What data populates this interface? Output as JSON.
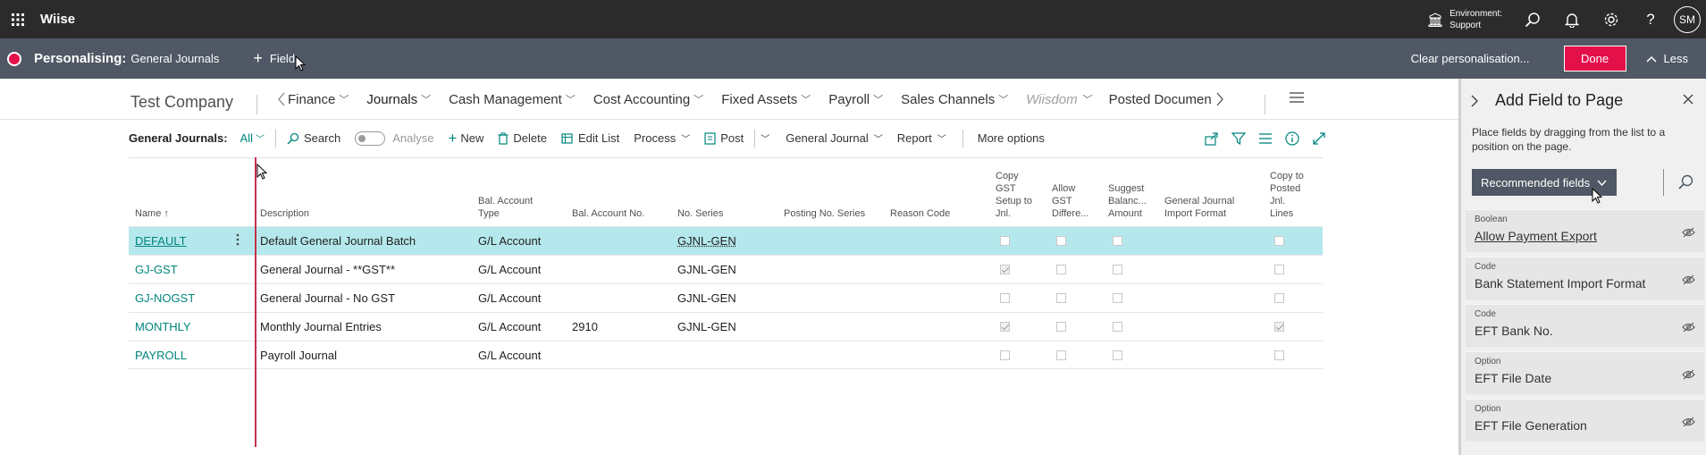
{
  "app": {
    "name": "Wiise"
  },
  "topbar": {
    "environment_label": "Environment:",
    "environment_value": "Support",
    "avatar_initials": "SM"
  },
  "personalise": {
    "title": "Personalising:",
    "page": "General Journals",
    "add_field": "Field",
    "clear": "Clear personalisation...",
    "done": "Done",
    "less": "Less"
  },
  "page": {
    "company": "Test Company",
    "nav": [
      {
        "label": "Finance",
        "state": "normal"
      },
      {
        "label": "Journals",
        "state": "active"
      },
      {
        "label": "Cash Management",
        "state": "normal"
      },
      {
        "label": "Cost Accounting",
        "state": "normal"
      },
      {
        "label": "Fixed Assets",
        "state": "normal"
      },
      {
        "label": "Payroll",
        "state": "normal"
      },
      {
        "label": "Sales Channels",
        "state": "normal"
      },
      {
        "label": "Wiisdom",
        "state": "disabled"
      },
      {
        "label": "Posted Documen",
        "state": "normal"
      }
    ],
    "actions": {
      "list_label": "General Journals:",
      "filter": "All",
      "search": "Search",
      "analyse": "Analyse",
      "new": "New",
      "delete": "Delete",
      "edit_list": "Edit List",
      "process": "Process",
      "post": "Post",
      "general_journal": "General Journal",
      "report": "Report",
      "more": "More options"
    }
  },
  "table": {
    "headers": {
      "name": "Name ↑",
      "description": "Description",
      "bal_type": [
        "Bal. Account",
        "Type"
      ],
      "bal_no": "Bal. Account No.",
      "no_series": "No. Series",
      "posting_series": "Posting No. Series",
      "reason": "Reason Code",
      "copy_gst": [
        "Copy",
        "GST",
        "Setup to",
        "Jnl."
      ],
      "allow_gst": [
        "Allow",
        "GST",
        "Differe..."
      ],
      "suggest": [
        "Suggest",
        "Balanc...",
        "Amount"
      ],
      "import_format": [
        "General Journal",
        "Import Format"
      ],
      "copy_posted": [
        "Copy to",
        "Posted",
        "Jnl.",
        "Lines"
      ]
    },
    "rows": [
      {
        "name": "DEFAULT",
        "description": "Default General Journal Batch",
        "bal_type": "G/L Account",
        "bal_no": "",
        "no_series": "GJNL-GEN",
        "copy_gst": false,
        "allow_gst": false,
        "suggest": false,
        "copy_posted": false,
        "selected": true
      },
      {
        "name": "GJ-GST",
        "description": "General Journal - **GST**",
        "bal_type": "G/L Account",
        "bal_no": "",
        "no_series": "GJNL-GEN",
        "copy_gst": true,
        "allow_gst": false,
        "suggest": false,
        "copy_posted": false,
        "selected": false
      },
      {
        "name": "GJ-NOGST",
        "description": "General Journal - No GST",
        "bal_type": "G/L Account",
        "bal_no": "",
        "no_series": "GJNL-GEN",
        "copy_gst": false,
        "allow_gst": false,
        "suggest": false,
        "copy_posted": false,
        "selected": false
      },
      {
        "name": "MONTHLY",
        "description": "Monthly Journal Entries",
        "bal_type": "G/L Account",
        "bal_no": "2910",
        "no_series": "GJNL-GEN",
        "copy_gst": true,
        "allow_gst": false,
        "suggest": false,
        "copy_posted": true,
        "selected": false
      },
      {
        "name": "PAYROLL",
        "description": "Payroll Journal",
        "bal_type": "G/L Account",
        "bal_no": "",
        "no_series": "",
        "copy_gst": false,
        "allow_gst": false,
        "suggest": false,
        "copy_posted": false,
        "selected": false
      }
    ]
  },
  "panel": {
    "title": "Add Field to Page",
    "description": "Place fields by dragging from the list to a position on the page.",
    "filter_button": "Recommended fields",
    "fields": [
      {
        "type": "Boolean",
        "name": "Allow Payment Export"
      },
      {
        "type": "Code",
        "name": "Bank Statement Import Format"
      },
      {
        "type": "Code",
        "name": "EFT Bank No."
      },
      {
        "type": "Option",
        "name": "EFT File Date"
      },
      {
        "type": "Option",
        "name": "EFT File Generation"
      }
    ]
  },
  "colors": {
    "accent": "#e3104a",
    "link": "#00857d",
    "topbar": "#2b2b2b",
    "pbar": "#505865",
    "selected_row": "#b5e8ec"
  }
}
